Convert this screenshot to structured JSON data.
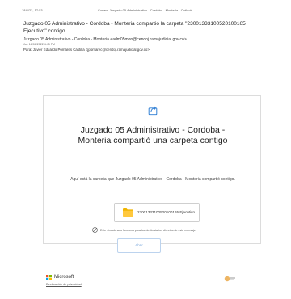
{
  "print_header": {
    "datetime": "18/8/22, 17:53",
    "tab_title": "Correo: Juzgado 05 Administrativo - Cordoba - Monteria - Outlook"
  },
  "email": {
    "subject": "Juzgado 05 Administrativo - Cordoba - Monteria compartió la carpeta \"23001333100520100165 Ejecutivo\" contigo.",
    "from": "Juzgado 05 Administrativo - Cordoba - Monteria <adm05mon@cendoj.ramajudicial.gov.co>",
    "date": "Jue 18/08/2022 4:45 PM",
    "to": "Para: Javier Eduardo Pomares Castilla <jpomarec@cendoj.ramajudicial.gov.co>"
  },
  "card": {
    "share_icon": "share-arrow-icon",
    "title": "Juzgado 05 Administrativo - Cordoba - Monteria compartió una carpeta contigo",
    "description": "Aquí está la carpeta que Juzgado 05 Administrativo - Cordoba - Monteria compartió contigo.",
    "folder_icon": "folder-icon",
    "folder_name": "23001333100520100165 Ejecutivo",
    "notice_icon": "globe-icon",
    "notice": "Este vínculo solo funciona para los destinatarios directos de este mensaje.",
    "open_button": "Abrir",
    "colors": {
      "accent": "#2b7cd3",
      "folder": "#f0b400"
    }
  },
  "footer": {
    "brand": "Microsoft",
    "privacy": "Declaración de privacidad",
    "seal_icon": "seal-icon"
  }
}
